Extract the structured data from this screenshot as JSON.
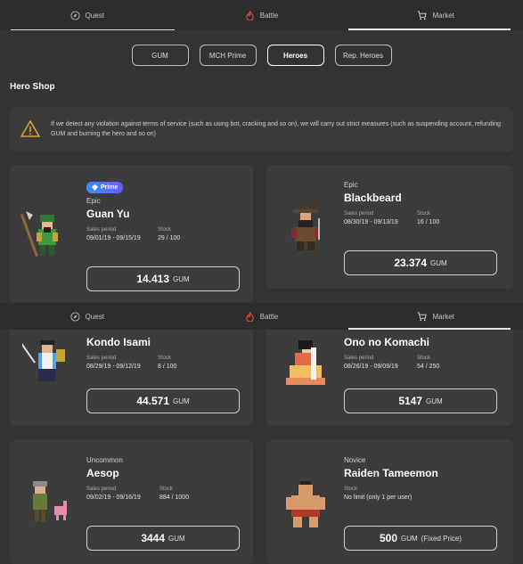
{
  "nav": {
    "tabs": [
      {
        "label": "Quest",
        "icon": "compass-icon"
      },
      {
        "label": "Battle",
        "icon": "flame-icon"
      },
      {
        "label": "Market",
        "icon": "cart-icon"
      }
    ],
    "active": "Market"
  },
  "filters": [
    "GUM",
    "MCH Prime",
    "Heroes",
    "Rep. Heroes"
  ],
  "filters_active": "Heroes",
  "section_title": "Hero Shop",
  "notice": "If we detect any violation against terms of service (such as using bot, cracking and so on), we will carry out strict measures (such as suspending account, refunding GUM and burning the hero and so on)",
  "labels": {
    "sales_period": "Sales period",
    "stock": "Stock",
    "currency": "GUM",
    "prime": "Prime"
  },
  "heroes": [
    {
      "rarity": "Epic",
      "name": "Guan Yu",
      "prime": true,
      "period": "09/01/19 - 09/15/19",
      "stock": "29 / 100",
      "price": "14.413",
      "price_suffix": ""
    },
    {
      "rarity": "Epic",
      "name": "Blackbeard",
      "prime": false,
      "period": "08/30/19 - 09/13/19",
      "stock": "16 / 100",
      "price": "23.374",
      "price_suffix": ""
    },
    {
      "rarity": "",
      "name": "Kondo Isami",
      "prime": false,
      "period": "08/29/19 - 09/12/19",
      "stock": "8 / 100",
      "price": "44.571",
      "price_suffix": ""
    },
    {
      "rarity": "",
      "name": "Ono no Komachi",
      "prime": false,
      "period": "08/26/19 - 09/09/19",
      "stock": "54 / 250",
      "price": "5147",
      "price_suffix": ""
    },
    {
      "rarity": "Uncommon",
      "name": "Aesop",
      "prime": false,
      "period": "09/02/19 - 09/16/19",
      "stock": "884 / 1000",
      "price": "3444",
      "price_suffix": ""
    },
    {
      "rarity": "Novice",
      "name": "Raiden Tameemon",
      "prime": false,
      "period": "",
      "stock": "No limit (only 1 per user)",
      "price": "500",
      "price_suffix": "(Fixed Price)"
    }
  ],
  "colors": {
    "bg": "#333333",
    "card": "#3c3c3c",
    "accent_blue": "#3d8bff",
    "battle_red": "#e0533a"
  }
}
